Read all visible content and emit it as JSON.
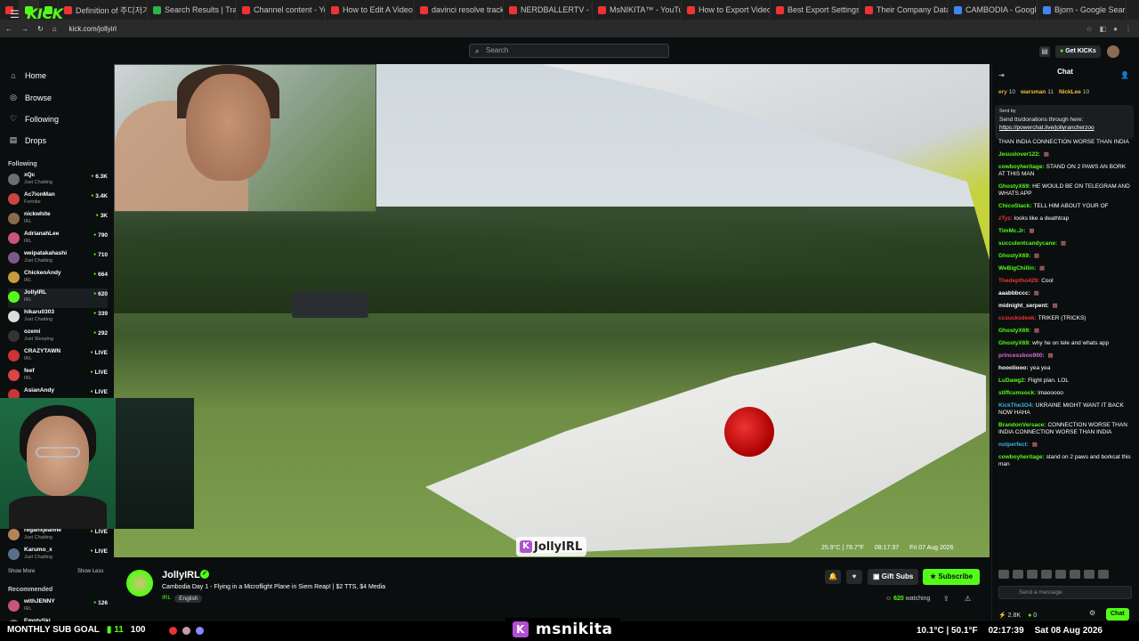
{
  "browser": {
    "tabs": [
      {
        "label": "",
        "color": "#e33"
      },
      {
        "label": "",
        "color": "#53fc18"
      },
      {
        "label": "",
        "color": "#53fc18"
      },
      {
        "label": "Definition of 주디저기",
        "color": "#e33"
      },
      {
        "label": "Search Results | Trainin",
        "color": "#2db34a"
      },
      {
        "label": "Channel content - YouT",
        "color": "#e33"
      },
      {
        "label": "How to Edit A Video in",
        "color": "#e33"
      },
      {
        "label": "davinci resolve track, n",
        "color": "#e33"
      },
      {
        "label": "NERDBALLERTV - YouT",
        "color": "#e33"
      },
      {
        "label": "MsNIKITA™ - YouTube",
        "color": "#e33"
      },
      {
        "label": "How to Export Videos",
        "color": "#e33"
      },
      {
        "label": "Best Export Settings in",
        "color": "#e33"
      },
      {
        "label": "Their Company Data is",
        "color": "#e33"
      },
      {
        "label": "CAMBODIA - Google S",
        "color": "#4285f4"
      },
      {
        "label": "Bjorn - Google Search",
        "color": "#4285f4"
      }
    ],
    "url": "kick.com/jollyirl"
  },
  "topnav": {
    "logo": "KICK",
    "search_placeholder": "Search",
    "get_kicks": "Get KICKs"
  },
  "sidebar": {
    "nav": [
      {
        "label": "Home",
        "icon": "home-icon"
      },
      {
        "label": "Browse",
        "icon": "compass-icon"
      },
      {
        "label": "Following",
        "icon": "heart-icon"
      },
      {
        "label": "Drops",
        "icon": "drops-icon"
      }
    ],
    "following_title": "Following",
    "following": [
      {
        "name": "xQc",
        "category": "Just Chatting",
        "viewers": "6.3K",
        "color": "#6a6f73"
      },
      {
        "name": "Ac7ionMan",
        "category": "Fortnite",
        "viewers": "3.4K",
        "color": "#c44"
      },
      {
        "name": "nickwhite",
        "category": "IRL",
        "viewers": "3K",
        "color": "#8a6a4a"
      },
      {
        "name": "AdrianahLee",
        "category": "IRL",
        "viewers": "790",
        "color": "#c7557a"
      },
      {
        "name": "weipatakahashi",
        "category": "Just Chatting",
        "viewers": "710",
        "color": "#7a5a8a"
      },
      {
        "name": "ChickenAndy",
        "category": "IRL",
        "viewers": "664",
        "color": "#c89a3a"
      },
      {
        "name": "JollyIRL",
        "category": "IRL",
        "viewers": "620",
        "color": "#53fc18"
      },
      {
        "name": "hikaru0303",
        "category": "Just Chatting",
        "viewers": "339",
        "color": "#ddd"
      },
      {
        "name": "ozemi",
        "category": "Just Sleeping",
        "viewers": "292",
        "color": "#333"
      },
      {
        "name": "CRAZYTAWN",
        "category": "IRL",
        "viewers": "LIVE",
        "color": "#c33"
      },
      {
        "name": "feef",
        "category": "IRL",
        "viewers": "LIVE",
        "color": "#d44"
      },
      {
        "name": "AsianAndy",
        "category": "",
        "viewers": "LIVE",
        "color": "#c33"
      }
    ],
    "following_tail": [
      {
        "name": "reganxjeanne",
        "category": "Just Chatting",
        "viewers": "LIVE",
        "color": "#b5835a"
      },
      {
        "name": "Karumo_x",
        "category": "Just Chatting",
        "viewers": "LIVE",
        "color": "#5a6f8a"
      }
    ],
    "show_more": "Show More",
    "show_less": "Show Less",
    "recommended_title": "Recommended",
    "recommended": [
      {
        "name": "withJENNY",
        "category": "IRL",
        "viewers": "126",
        "color": "#c7557a"
      },
      {
        "name": "EmptySki",
        "category": "",
        "viewers": "",
        "color": "#777"
      }
    ]
  },
  "player": {
    "watermark": "JollyIRL",
    "temp": "25.9°C | 78.7°F",
    "time": "08:17:37",
    "date": "Fri 07 Aug 2026"
  },
  "channel": {
    "name": "JollyIRL",
    "title": "Cambodia Day 1 - Flying in a Microflight Plane in Siem Reap! | $2 TTS, $4 Media",
    "category": "IRL",
    "language": "English",
    "gift_subs": "Gift Subs",
    "subscribe": "Subscribe",
    "watching_count": "620",
    "watching_label": "watching"
  },
  "chat": {
    "title": "Chat",
    "gifters": [
      {
        "name": "ery",
        "count": "10",
        "color": "#e9a33a"
      },
      {
        "name": "warsman",
        "count": "11",
        "color": "#e9c23a"
      },
      {
        "name": "NickLee",
        "count": "10",
        "color": "#e9c23a"
      }
    ],
    "pinned_sent_by": "Sent by",
    "pinned_text": "Send tts/donations through here:",
    "pinned_link": "https://powerchat.live/jollyrancherzoo",
    "messages": [
      {
        "user": "",
        "text": "THAN INDIA CONNECTION WORSE THAN INDIA",
        "color": "#fff"
      },
      {
        "user": "Jesuslover122:",
        "text": "",
        "color": "#53fc18"
      },
      {
        "user": "cowboyheritage:",
        "text": "STAND ON 2 PAWS AN BORK AT THIS MAN",
        "color": "#53fc18"
      },
      {
        "user": "GhostyX69:",
        "text": "HE WOULD BE ON TELEGRAM AND WHATS APP",
        "color": "#53fc18"
      },
      {
        "user": "ChicoStack:",
        "text": "TELL HIM ABOUT YOUR OF",
        "color": "#53fc18"
      },
      {
        "user": "zTyz:",
        "text": "looks like a deathtrap",
        "color": "#e33"
      },
      {
        "user": "TimMc.Jr:",
        "text": "",
        "color": "#53fc18"
      },
      {
        "user": "succulentcandycane:",
        "text": "",
        "color": "#53fc18"
      },
      {
        "user": "GhostyX69:",
        "text": "",
        "color": "#53fc18"
      },
      {
        "user": "WeBigChillin:",
        "text": "",
        "color": "#53fc18"
      },
      {
        "user": "Thedeptho429:",
        "text": "Cool",
        "color": "#e33"
      },
      {
        "user": "aaabbbccc:",
        "text": "",
        "color": "#fff"
      },
      {
        "user": "midnight_serpent:",
        "text": "",
        "color": "#fff"
      },
      {
        "user": "ccsucksdeek:",
        "text": "TRIKER (TRICKS)",
        "color": "#e33"
      },
      {
        "user": "GhostyX69:",
        "text": "",
        "color": "#53fc18"
      },
      {
        "user": "GhostyX69:",
        "text": "why he on tele and whats app",
        "color": "#53fc18"
      },
      {
        "user": "princessboo900:",
        "text": "",
        "color": "#e06ad8"
      },
      {
        "user": "hoooliooo:",
        "text": "yea yea",
        "color": "#fff"
      },
      {
        "user": "LuDawg2:",
        "text": "Flight plan. LOL",
        "color": "#53fc18"
      },
      {
        "user": "stiffcumsock:",
        "text": "lmaooooo",
        "color": "#53fc18"
      },
      {
        "user": "KickThe3O4:",
        "text": "UKRAINE MIGHT WANT IT BACK NOW HAHA",
        "color": "#3ab0e9"
      },
      {
        "user": "BrandonVersace:",
        "text": "CONNECTION WORSE THAN INDIA CONNECTION WORSE THAN INDIA",
        "color": "#53fc18"
      },
      {
        "user": "notperfect:",
        "text": "",
        "color": "#3ab0e9"
      },
      {
        "user": "cowboyheritage:",
        "text": "stand on 2 paws and borkcat this man",
        "color": "#53fc18"
      }
    ],
    "input_placeholder": "Send a message",
    "kicks_count": "2.8K",
    "zero_count": "0",
    "chat_button": "Chat"
  },
  "stream_overlay": {
    "sub_goal_label": "MONTHLY SUB GOAL",
    "sub_goal_current": "11",
    "sub_goal_target": "100",
    "streamer_name": "msnikita",
    "temp": "10.1°C | 50.1°F",
    "time": "02:17:39",
    "date": "Sat 08 Aug 2026"
  }
}
